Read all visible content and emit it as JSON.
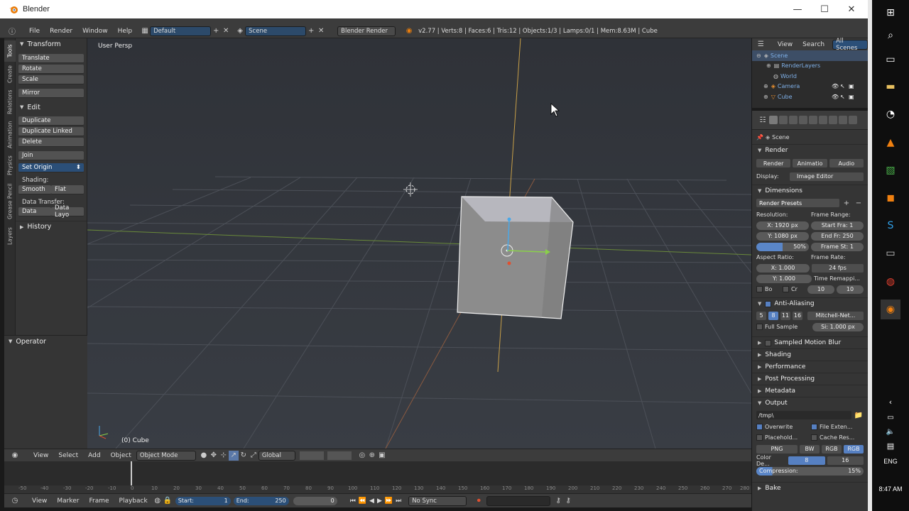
{
  "window": {
    "title": "Blender",
    "app_icon": "blender-logo-icon"
  },
  "info_header": {
    "menus": [
      "File",
      "Render",
      "Window",
      "Help"
    ],
    "layout": "Default",
    "scene": "Scene",
    "engine": "Blender Render",
    "stats": "v2.77 | Verts:8 | Faces:6 | Tris:12 | Objects:1/3 | Lamps:0/1 | Mem:8.63M | Cube"
  },
  "left_tabs": [
    "Tools",
    "Create",
    "Relations",
    "Animation",
    "Physics",
    "Grease Pencil",
    "Layers"
  ],
  "tool_shelf": {
    "transform_title": "Transform",
    "translate": "Translate",
    "rotate": "Rotate",
    "scale": "Scale",
    "mirror": "Mirror",
    "edit_title": "Edit",
    "duplicate": "Duplicate",
    "duplicate_linked": "Duplicate Linked",
    "delete": "Delete",
    "join": "Join",
    "set_origin": "Set Origin",
    "shading_label": "Shading:",
    "smooth": "Smooth",
    "flat": "Flat",
    "data_transfer_label": "Data Transfer:",
    "data": "Data",
    "data_layout": "Data Layo",
    "history_title": "History",
    "operator_title": "Operator"
  },
  "viewport": {
    "view_name": "User Persp",
    "object_label": "(0) Cube"
  },
  "view3d_header": {
    "view": "View",
    "select": "Select",
    "add": "Add",
    "object": "Object",
    "mode": "Object Mode",
    "orientation": "Global"
  },
  "timeline": {
    "ruler": [
      "-50",
      "-40",
      "-30",
      "-20",
      "-10",
      "0",
      "10",
      "20",
      "30",
      "40",
      "50",
      "60",
      "70",
      "80",
      "90",
      "100",
      "110",
      "120",
      "130",
      "140",
      "150",
      "160",
      "170",
      "180",
      "190",
      "200",
      "210",
      "220",
      "230",
      "240",
      "250",
      "260",
      "270",
      "280"
    ],
    "view": "View",
    "marker": "Marker",
    "frame": "Frame",
    "playback": "Playback",
    "start_label": "Start:",
    "start_value": "1",
    "end_label": "End:",
    "end_value": "250",
    "current": "0",
    "sync": "No Sync"
  },
  "outliner": {
    "view": "View",
    "search": "Search",
    "filter": "All Scenes",
    "items": [
      "Scene",
      "RenderLayers",
      "World",
      "Camera",
      "Cube"
    ]
  },
  "properties": {
    "breadcrumb": "Scene",
    "render_title": "Render",
    "render_btn": "Render",
    "animation_btn": "Animatio",
    "audio_btn": "Audio",
    "display_label": "Display:",
    "display_value": "Image Editor",
    "dimensions_title": "Dimensions",
    "render_presets": "Render Presets",
    "resolution_label": "Resolution:",
    "res_x": "X:  1920 px",
    "res_y": "Y:  1080 px",
    "res_pct": "50%",
    "frame_range_label": "Frame Range:",
    "start_frame": "Start Fra:  1",
    "end_frame": "End Fr: 250",
    "frame_step": "Frame St:  1",
    "aspect_label": "Aspect Ratio:",
    "aspect_x": "X:   1.000",
    "aspect_y": "Y:   1.000",
    "frame_rate_label": "Frame Rate:",
    "frame_rate": "24 fps",
    "time_remap_label": "Time Remappi...",
    "remap_old": "10",
    "remap_new": "10",
    "border": "Bo",
    "crop": "Cr",
    "aa_title": "Anti-Aliasing",
    "aa_samples": [
      "5",
      "8",
      "11",
      "16"
    ],
    "aa_filter": "Mitchell-Net...",
    "full_sample": "Full Sample",
    "filter_size": "Si: 1.000 px",
    "motion_blur": "Sampled Motion Blur",
    "shading": "Shading",
    "performance": "Performance",
    "post_processing": "Post Processing",
    "metadata": "Metadata",
    "output_title": "Output",
    "output_path": "/tmp\\",
    "overwrite": "Overwrite",
    "file_extensions": "File Exten...",
    "placeholders": "Placehold...",
    "cache_result": "Cache Res...",
    "format": "PNG",
    "bw": "BW",
    "rgb": "RGB",
    "rgba": "RGB",
    "color_depth_label": "Color De...",
    "depth_8": "8",
    "depth_16": "16",
    "compression": "Compression:",
    "compression_value": "15%",
    "bake": "Bake"
  },
  "taskbar": {
    "language": "ENG",
    "time": "8:47 AM"
  }
}
